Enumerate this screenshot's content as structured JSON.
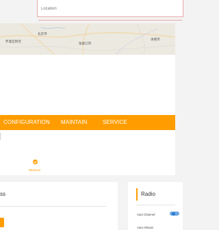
{
  "location_field": {
    "placeholder": "Location"
  },
  "map": {
    "labels": [
      "北京市",
      "怀柔区附近",
      "张家口市",
      "承德市"
    ]
  },
  "nav": {
    "items": [
      "CONFIGURATION",
      "MAINTAIN",
      "SERVICE"
    ]
  },
  "stepper": {
    "active_step_label": "Wireless"
  },
  "left_panel": {
    "title": "ss"
  },
  "right_panel": {
    "title": "Radio",
    "fields": {
      "auto_channel": "Auto Channel:",
      "auto_allocation": "Auto Allocati"
    }
  },
  "colors": {
    "accent": "#ff9d00",
    "toggle": "#2b7fd3"
  }
}
